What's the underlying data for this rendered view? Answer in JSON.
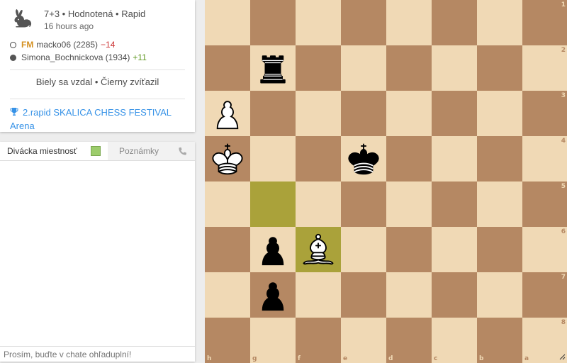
{
  "game": {
    "icon": "rabbit-icon",
    "title": "7+3 • Hodnotená • Rapid",
    "time_ago": "16 hours ago",
    "players": [
      {
        "color": "white",
        "title": "FM",
        "name": "macko06 (2285)",
        "diff": "−14",
        "diff_sign": "neg",
        "marker": "white-circle-icon"
      },
      {
        "color": "black",
        "title": "",
        "name": "Simona_Bochnickova (1934)",
        "diff": "+11",
        "diff_sign": "pos",
        "marker": "black-circle-icon"
      }
    ],
    "result": "Biely sa vzdal • Čierny zvíťazil",
    "tournament": "2.rapid SKALICA CHESS FESTIVAL Arena"
  },
  "chat": {
    "tab_chat": "Divácka miestnosť",
    "tab_notes": "Poznámky",
    "placeholder": "Prosím, buďte v chate ohľaduplní!"
  },
  "board": {
    "orientation": "black",
    "ranks": [
      "1",
      "2",
      "3",
      "4",
      "5",
      "6",
      "7",
      "8"
    ],
    "files": [
      "h",
      "g",
      "f",
      "e",
      "d",
      "c",
      "b",
      "a"
    ],
    "highlight_squares": [
      "g5",
      "f6"
    ],
    "colors": {
      "light": "#f0d9b5",
      "dark": "#b58863",
      "highlight_light": "#cdd26a",
      "highlight_dark": "#aaa23a",
      "link": "#3692e7"
    },
    "pieces": [
      {
        "square": "g2",
        "piece": "black-rook"
      },
      {
        "square": "h3",
        "piece": "white-pawn"
      },
      {
        "square": "h4",
        "piece": "white-king"
      },
      {
        "square": "e4",
        "piece": "black-king"
      },
      {
        "square": "g6",
        "piece": "black-pawn"
      },
      {
        "square": "f6",
        "piece": "white-bishop"
      },
      {
        "square": "g7",
        "piece": "black-pawn"
      }
    ]
  }
}
